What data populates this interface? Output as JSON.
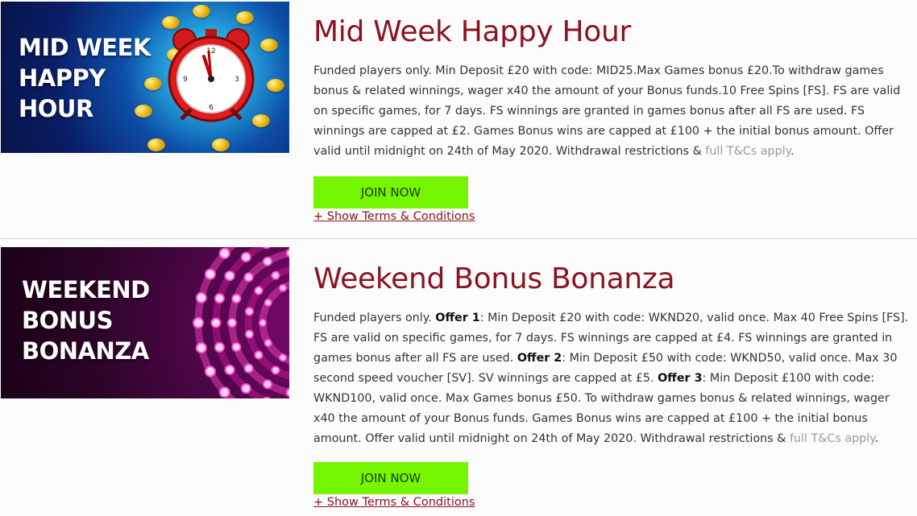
{
  "promos": [
    {
      "banner_lines": [
        "MID WEEK",
        "HAPPY",
        "HOUR"
      ],
      "title": "Mid Week Happy Hour",
      "desc": [
        "Funded players only. Min Deposit £20 with code: MID25.Max Games bonus £20.To withdraw games bonus & related winnings, wager x40 the amount of your Bonus funds.10 Free Spins [FS]. FS are valid on specific games, for 7 days. FS winnings are granted in games bonus after all FS are used. FS winnings are capped at £2. Games Bonus wins are capped at £100 + the initial bonus amount. Offer valid until midnight on 24th of May 2020. Withdrawal restrictions & "
      ],
      "tc_link": "full T&Cs apply",
      "tc_suffix": ".",
      "join_label": "JOIN NOW",
      "terms_label": "+ Show Terms & Conditions"
    },
    {
      "banner_lines": [
        "WEEKEND",
        "BONUS",
        "BONANZA"
      ],
      "title": "Weekend Bonus Bonanza",
      "desc": {
        "intro": "Funded players only. ",
        "offer1_label": "Offer 1",
        "offer1_text": ": Min Deposit £20 with code: WKND20, valid once. Max 40 Free Spins [FS]. FS are valid on specific games, for 7 days. FS winnings are capped at £4. FS winnings are granted in games bonus after all FS are used. ",
        "offer2_label": "Offer 2",
        "offer2_text": ": Min Deposit £50 with code: WKND50, valid once. Max 30 second speed voucher [SV]. SV winnings are capped at £5. ",
        "offer3_label": "Offer 3",
        "offer3_text": ": Min Deposit £100 with code: WKND100, valid once. Max Games bonus £50. To withdraw games bonus & related winnings, wager x40 the amount of your Bonus funds. Games Bonus wins are capped at £100 + the initial bonus amount. Offer valid until midnight on 24th of May 2020. Withdrawal restrictions & "
      },
      "tc_link": "full T&Cs apply",
      "tc_suffix": ".",
      "join_label": "JOIN NOW",
      "terms_label": "+ Show Terms & Conditions"
    }
  ],
  "colors": {
    "title": "#8c1222",
    "join_button": "#76f500",
    "tc_link": "#9b9b9b",
    "terms_link": "#8c1222"
  },
  "icons": {
    "banner_1": "alarm-clock-icon",
    "banner_2": "stage-lights-icon"
  }
}
